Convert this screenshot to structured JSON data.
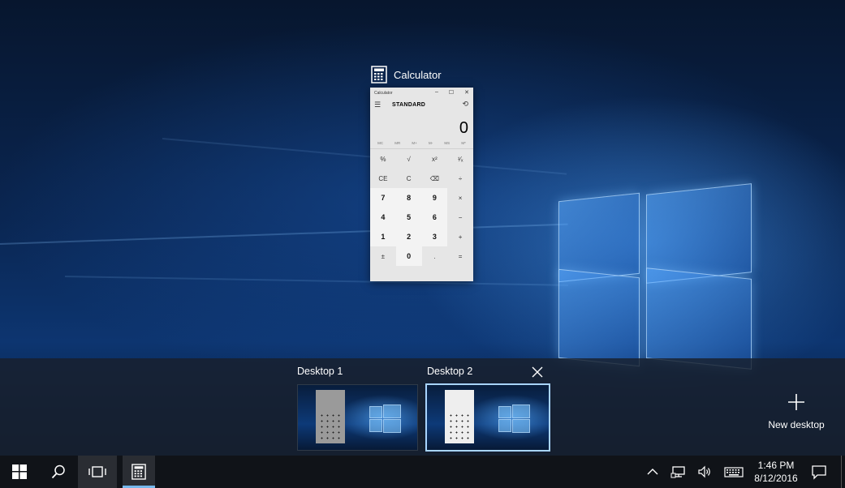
{
  "window_thumbnail": {
    "app_title": "Calculator",
    "calc": {
      "titlebar_text": "Calculator",
      "window_buttons": [
        "–",
        "☐",
        "✕"
      ],
      "mode": "STANDARD",
      "display_value": "0",
      "memory_buttons": [
        "MC",
        "MR",
        "M+",
        "M-",
        "MS",
        "M*"
      ],
      "keys": [
        "%",
        "√",
        "x²",
        "¹⁄ₓ",
        "CE",
        "C",
        "⌫",
        "÷",
        "7",
        "8",
        "9",
        "×",
        "4",
        "5",
        "6",
        "−",
        "1",
        "2",
        "3",
        "+",
        "±",
        "0",
        ".",
        "="
      ]
    }
  },
  "task_view": {
    "desktops": [
      {
        "label": "Desktop 1",
        "selected": false
      },
      {
        "label": "Desktop 2",
        "selected": true
      }
    ],
    "new_desktop_label": "New desktop"
  },
  "taskbar": {
    "start_icon": "windows-logo-icon",
    "search_icon": "search-icon",
    "task_view_icon": "task-view-icon",
    "pinned": [
      {
        "name": "calculator-icon",
        "active": true
      }
    ],
    "tray_icons": [
      "chevron-up-icon",
      "network-icon",
      "volume-icon",
      "keyboard-icon"
    ],
    "time": "1:46 PM",
    "date": "8/12/2016",
    "notification_icon": "action-center-icon"
  },
  "colors": {
    "accent": "#76b9ed",
    "taskbar_bg": "#101318",
    "selected_border": "#a8d4ff"
  }
}
